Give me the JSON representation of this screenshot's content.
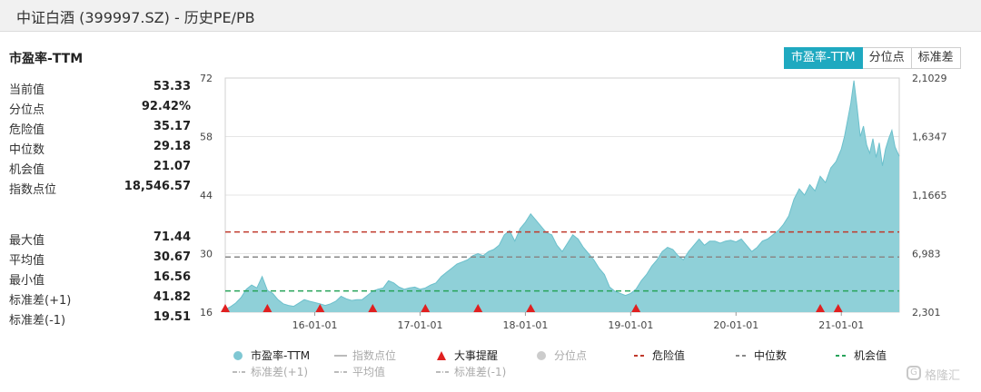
{
  "window": {
    "title": "中证白酒 (399997.SZ) - 历史PE/PB"
  },
  "stats": {
    "heading": "市盈率-TTM",
    "group1": [
      {
        "label": "当前值",
        "value": "53.33"
      },
      {
        "label": "分位点",
        "value": "92.42%"
      },
      {
        "label": "危险值",
        "value": "35.17"
      },
      {
        "label": "中位数",
        "value": "29.18"
      },
      {
        "label": "机会值",
        "value": "21.07"
      },
      {
        "label": "指数点位",
        "value": "18,546.57"
      }
    ],
    "group2": [
      {
        "label": "最大值",
        "value": "71.44"
      },
      {
        "label": "平均值",
        "value": "30.67"
      },
      {
        "label": "最小值",
        "value": "16.56"
      },
      {
        "label": "标准差(+1)",
        "value": "41.82"
      },
      {
        "label": "标准差(-1)",
        "value": "19.51"
      }
    ]
  },
  "tabs": [
    {
      "label": "市盈率-TTM",
      "active": true
    },
    {
      "label": "分位点",
      "active": false
    },
    {
      "label": "标准差",
      "active": false
    }
  ],
  "watermark": {
    "icon": "G",
    "text": "格隆汇"
  },
  "chart_data": {
    "type": "area",
    "y_left": {
      "ticks": [
        "16",
        "30",
        "44",
        "58",
        "72"
      ],
      "ylim": [
        16,
        72
      ]
    },
    "y_right": {
      "ticks": [
        "2,301",
        "6,983",
        "1,1665",
        "1,6347",
        "2,1029"
      ]
    },
    "x_ticks": [
      {
        "label": "16-01-01",
        "x": 2016.0
      },
      {
        "label": "17-01-01",
        "x": 2017.0
      },
      {
        "label": "18-01-01",
        "x": 2018.0
      },
      {
        "label": "19-01-01",
        "x": 2019.0
      },
      {
        "label": "20-01-01",
        "x": 2020.0
      },
      {
        "label": "21-01-01",
        "x": 2021.0
      }
    ],
    "xlim": [
      2015.15,
      2021.55
    ],
    "series": [
      {
        "name": "市盈率-TTM",
        "color": "#8fd0d8",
        "line_color": "#6cc0cc",
        "points": [
          [
            2015.15,
            16.6
          ],
          [
            2015.2,
            17.3
          ],
          [
            2015.25,
            18.2
          ],
          [
            2015.3,
            19.5
          ],
          [
            2015.35,
            21.5
          ],
          [
            2015.4,
            22.5
          ],
          [
            2015.45,
            21.8
          ],
          [
            2015.5,
            24.5
          ],
          [
            2015.55,
            21.2
          ],
          [
            2015.6,
            20.5
          ],
          [
            2015.65,
            19.0
          ],
          [
            2015.7,
            18.0
          ],
          [
            2015.75,
            17.6
          ],
          [
            2015.8,
            17.4
          ],
          [
            2015.85,
            18.2
          ],
          [
            2015.9,
            19.0
          ],
          [
            2015.95,
            18.6
          ],
          [
            2016.0,
            18.3
          ],
          [
            2016.05,
            18.0
          ],
          [
            2016.1,
            17.6
          ],
          [
            2016.15,
            18.0
          ],
          [
            2016.2,
            18.6
          ],
          [
            2016.25,
            19.8
          ],
          [
            2016.3,
            19.2
          ],
          [
            2016.35,
            18.8
          ],
          [
            2016.4,
            19.0
          ],
          [
            2016.45,
            19.0
          ],
          [
            2016.5,
            20.0
          ],
          [
            2016.55,
            21.0
          ],
          [
            2016.6,
            21.5
          ],
          [
            2016.65,
            21.8
          ],
          [
            2016.7,
            23.5
          ],
          [
            2016.75,
            23.0
          ],
          [
            2016.8,
            22.0
          ],
          [
            2016.85,
            21.5
          ],
          [
            2016.9,
            21.8
          ],
          [
            2016.95,
            22.0
          ],
          [
            2017.0,
            21.5
          ],
          [
            2017.05,
            21.8
          ],
          [
            2017.1,
            22.5
          ],
          [
            2017.15,
            23.0
          ],
          [
            2017.2,
            24.5
          ],
          [
            2017.25,
            25.5
          ],
          [
            2017.3,
            26.5
          ],
          [
            2017.35,
            27.5
          ],
          [
            2017.4,
            28.0
          ],
          [
            2017.45,
            28.5
          ],
          [
            2017.5,
            29.5
          ],
          [
            2017.55,
            30.0
          ],
          [
            2017.6,
            29.5
          ],
          [
            2017.65,
            30.5
          ],
          [
            2017.7,
            31.0
          ],
          [
            2017.75,
            32.0
          ],
          [
            2017.8,
            34.5
          ],
          [
            2017.85,
            35.5
          ],
          [
            2017.9,
            33.0
          ],
          [
            2017.95,
            36.0
          ],
          [
            2018.0,
            37.5
          ],
          [
            2018.05,
            39.5
          ],
          [
            2018.1,
            38.0
          ],
          [
            2018.15,
            36.5
          ],
          [
            2018.2,
            35.0
          ],
          [
            2018.25,
            34.5
          ],
          [
            2018.3,
            32.0
          ],
          [
            2018.35,
            30.5
          ],
          [
            2018.4,
            32.5
          ],
          [
            2018.45,
            34.5
          ],
          [
            2018.5,
            33.5
          ],
          [
            2018.55,
            31.5
          ],
          [
            2018.6,
            30.0
          ],
          [
            2018.65,
            28.5
          ],
          [
            2018.7,
            26.5
          ],
          [
            2018.75,
            25.0
          ],
          [
            2018.8,
            22.0
          ],
          [
            2018.85,
            21.0
          ],
          [
            2018.9,
            20.5
          ],
          [
            2018.95,
            20.0
          ],
          [
            2019.0,
            20.5
          ],
          [
            2019.05,
            21.5
          ],
          [
            2019.1,
            23.5
          ],
          [
            2019.15,
            25.0
          ],
          [
            2019.2,
            27.0
          ],
          [
            2019.25,
            28.5
          ],
          [
            2019.3,
            30.5
          ],
          [
            2019.35,
            31.5
          ],
          [
            2019.4,
            31.0
          ],
          [
            2019.45,
            29.5
          ],
          [
            2019.5,
            28.5
          ],
          [
            2019.55,
            30.5
          ],
          [
            2019.6,
            32.0
          ],
          [
            2019.65,
            33.5
          ],
          [
            2019.7,
            32.0
          ],
          [
            2019.75,
            33.0
          ],
          [
            2019.8,
            33.0
          ],
          [
            2019.85,
            32.5
          ],
          [
            2019.9,
            33.0
          ],
          [
            2019.95,
            33.2
          ],
          [
            2020.0,
            32.8
          ],
          [
            2020.05,
            33.5
          ],
          [
            2020.1,
            32.0
          ],
          [
            2020.15,
            30.5
          ],
          [
            2020.2,
            31.5
          ],
          [
            2020.25,
            33.0
          ],
          [
            2020.3,
            33.5
          ],
          [
            2020.35,
            34.5
          ],
          [
            2020.4,
            35.5
          ],
          [
            2020.45,
            37.0
          ],
          [
            2020.5,
            39.0
          ],
          [
            2020.55,
            43.0
          ],
          [
            2020.6,
            45.5
          ],
          [
            2020.65,
            44.0
          ],
          [
            2020.7,
            46.5
          ],
          [
            2020.75,
            45.0
          ],
          [
            2020.8,
            48.5
          ],
          [
            2020.85,
            47.0
          ],
          [
            2020.9,
            50.5
          ],
          [
            2020.95,
            52.0
          ],
          [
            2021.0,
            55.0
          ],
          [
            2021.03,
            58.0
          ],
          [
            2021.06,
            62.0
          ],
          [
            2021.09,
            66.0
          ],
          [
            2021.12,
            71.4
          ],
          [
            2021.15,
            65.0
          ],
          [
            2021.18,
            58.0
          ],
          [
            2021.21,
            60.5
          ],
          [
            2021.24,
            56.0
          ],
          [
            2021.27,
            54.0
          ],
          [
            2021.3,
            57.5
          ],
          [
            2021.33,
            53.0
          ],
          [
            2021.36,
            56.5
          ],
          [
            2021.39,
            51.0
          ],
          [
            2021.42,
            55.0
          ],
          [
            2021.45,
            57.5
          ],
          [
            2021.48,
            59.5
          ],
          [
            2021.51,
            55.5
          ],
          [
            2021.55,
            53.3
          ]
        ]
      }
    ],
    "hlines": [
      {
        "name": "危险值",
        "value": 35.17,
        "color": "#c0392b"
      },
      {
        "name": "中位数",
        "value": 29.18,
        "color": "#888888"
      },
      {
        "name": "机会值",
        "value": 21.07,
        "color": "#27a35a"
      }
    ],
    "events": [
      2015.15,
      2015.55,
      2016.05,
      2016.55,
      2017.05,
      2017.55,
      2018.05,
      2019.05,
      2020.8,
      2020.97
    ],
    "legend": {
      "row1": [
        {
          "label": "市盈率-TTM",
          "marker": "circle",
          "color": "#7fc7d3",
          "dim": false
        },
        {
          "label": "指数点位",
          "marker": "line",
          "color": "#bbbbbb",
          "dim": true
        },
        {
          "label": "大事提醒",
          "marker": "triangle",
          "color": "#e02020",
          "dim": false
        },
        {
          "label": "分位点",
          "marker": "circle",
          "color": "#cccccc",
          "dim": true
        },
        {
          "label": "危险值",
          "marker": "dash",
          "color": "#c0392b",
          "dim": false
        },
        {
          "label": "中位数",
          "marker": "dash",
          "color": "#888888",
          "dim": false
        },
        {
          "label": "机会值",
          "marker": "dash",
          "color": "#27a35a",
          "dim": false
        }
      ],
      "row2": [
        {
          "label": "标准差(+1)",
          "marker": "dashdot",
          "color": "#bbbbbb",
          "dim": true
        },
        {
          "label": "平均值",
          "marker": "dashdot",
          "color": "#bbbbbb",
          "dim": true
        },
        {
          "label": "标准差(-1)",
          "marker": "dashdot",
          "color": "#bbbbbb",
          "dim": true
        }
      ]
    }
  }
}
